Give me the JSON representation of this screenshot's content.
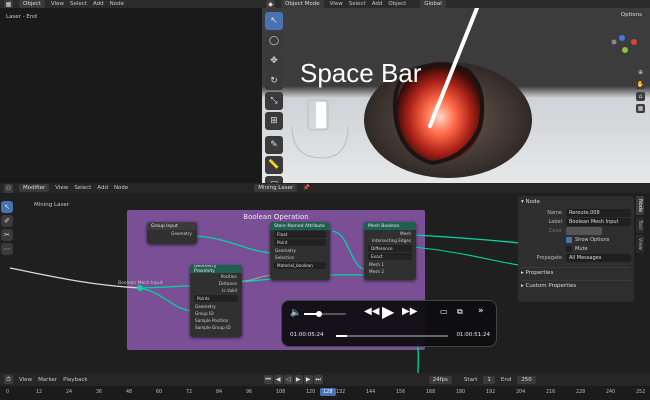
{
  "viewport_header": {
    "mode": "Object",
    "menus": [
      "View",
      "Select",
      "Add",
      "Node"
    ]
  },
  "left_panel": {
    "label": "Laser - End"
  },
  "viewport3d": {
    "mode": "Object Mode",
    "menus": [
      "View",
      "Select",
      "Add",
      "Object"
    ],
    "orientation": "Global",
    "options": "Options",
    "overlay_text": "Space Bar"
  },
  "node_editor_header": {
    "editor": "Modifier",
    "menus": [
      "View",
      "Select",
      "Add",
      "Node"
    ],
    "tree_name": "Mining Laser",
    "breadcrumb": "Mining Laser"
  },
  "frame": {
    "label": "Boolean Operation",
    "color": "#7a4f96"
  },
  "nodes": {
    "group_input": {
      "title": "Group Input",
      "out": "Geometry"
    },
    "mesh_boolean": {
      "title": "Mesh Boolean",
      "outputs": [
        "Mesh",
        "Intersecting Edges"
      ],
      "operation": "Difference",
      "solver": "Exact",
      "inputs": [
        "Mesh 1",
        "Mesh 2"
      ]
    },
    "store_attr": {
      "title": "Store Named Attribute",
      "type": "Float",
      "domain": "Point",
      "inputs": [
        "Geometry",
        "Selection"
      ],
      "name": "Material_boolean",
      "value": "Value"
    },
    "geo_proximity": {
      "title": "Geometry Proximity",
      "outputs": [
        "Position",
        "Distance",
        "Is Valid"
      ],
      "mode": "Points",
      "inputs": [
        "Geometry",
        "Group ID",
        "Sample Position",
        "Sample Group ID"
      ]
    },
    "reroute": {
      "label": "Boolean Mesh Input"
    }
  },
  "node_panel": {
    "tabs": [
      "Node",
      "Tool",
      "View"
    ],
    "section": "Node",
    "name_label": "Name",
    "name_value": "Reroute.008",
    "label_label": "Label",
    "label_value": "Boolean Mesh Input",
    "color_label": "Color",
    "show_options": "Show Options",
    "mute": "Mute",
    "propagate_label": "Propagate",
    "propagate_value": "All Messages",
    "properties": "Properties",
    "custom_properties": "Custom Properties"
  },
  "media_player": {
    "current_time": "01:00:05:24",
    "total_time": "01:00:51:24",
    "volume": 0.35,
    "progress": 0.1
  },
  "timeline": {
    "menus": [
      "View",
      "Marker",
      "Playback"
    ],
    "fps": "24fps",
    "start_label": "Start",
    "start_value": "1",
    "end_label": "End",
    "end_value": "250",
    "current_frame": "128",
    "ticks": [
      "0",
      "12",
      "24",
      "36",
      "48",
      "60",
      "72",
      "84",
      "96",
      "108",
      "120",
      "132",
      "144",
      "156",
      "168",
      "180",
      "192",
      "204",
      "216",
      "228",
      "240",
      "252"
    ]
  },
  "colors": {
    "accent": "#4772b3",
    "geometry_socket": "#00d6a3",
    "float_socket": "#a1a1a1",
    "vector_socket": "#6363c7",
    "node_header_geo": "#1f5f4f",
    "node_header_group": "#3b3b3b"
  },
  "icons": [
    "cursor-icon",
    "move-icon",
    "rotate-icon",
    "scale-icon",
    "transform-icon",
    "annotate-icon",
    "measure-icon",
    "play-icon",
    "rewind-icon",
    "forward-icon",
    "volume-icon",
    "subtitles-icon",
    "pip-icon",
    "skip-icon"
  ]
}
